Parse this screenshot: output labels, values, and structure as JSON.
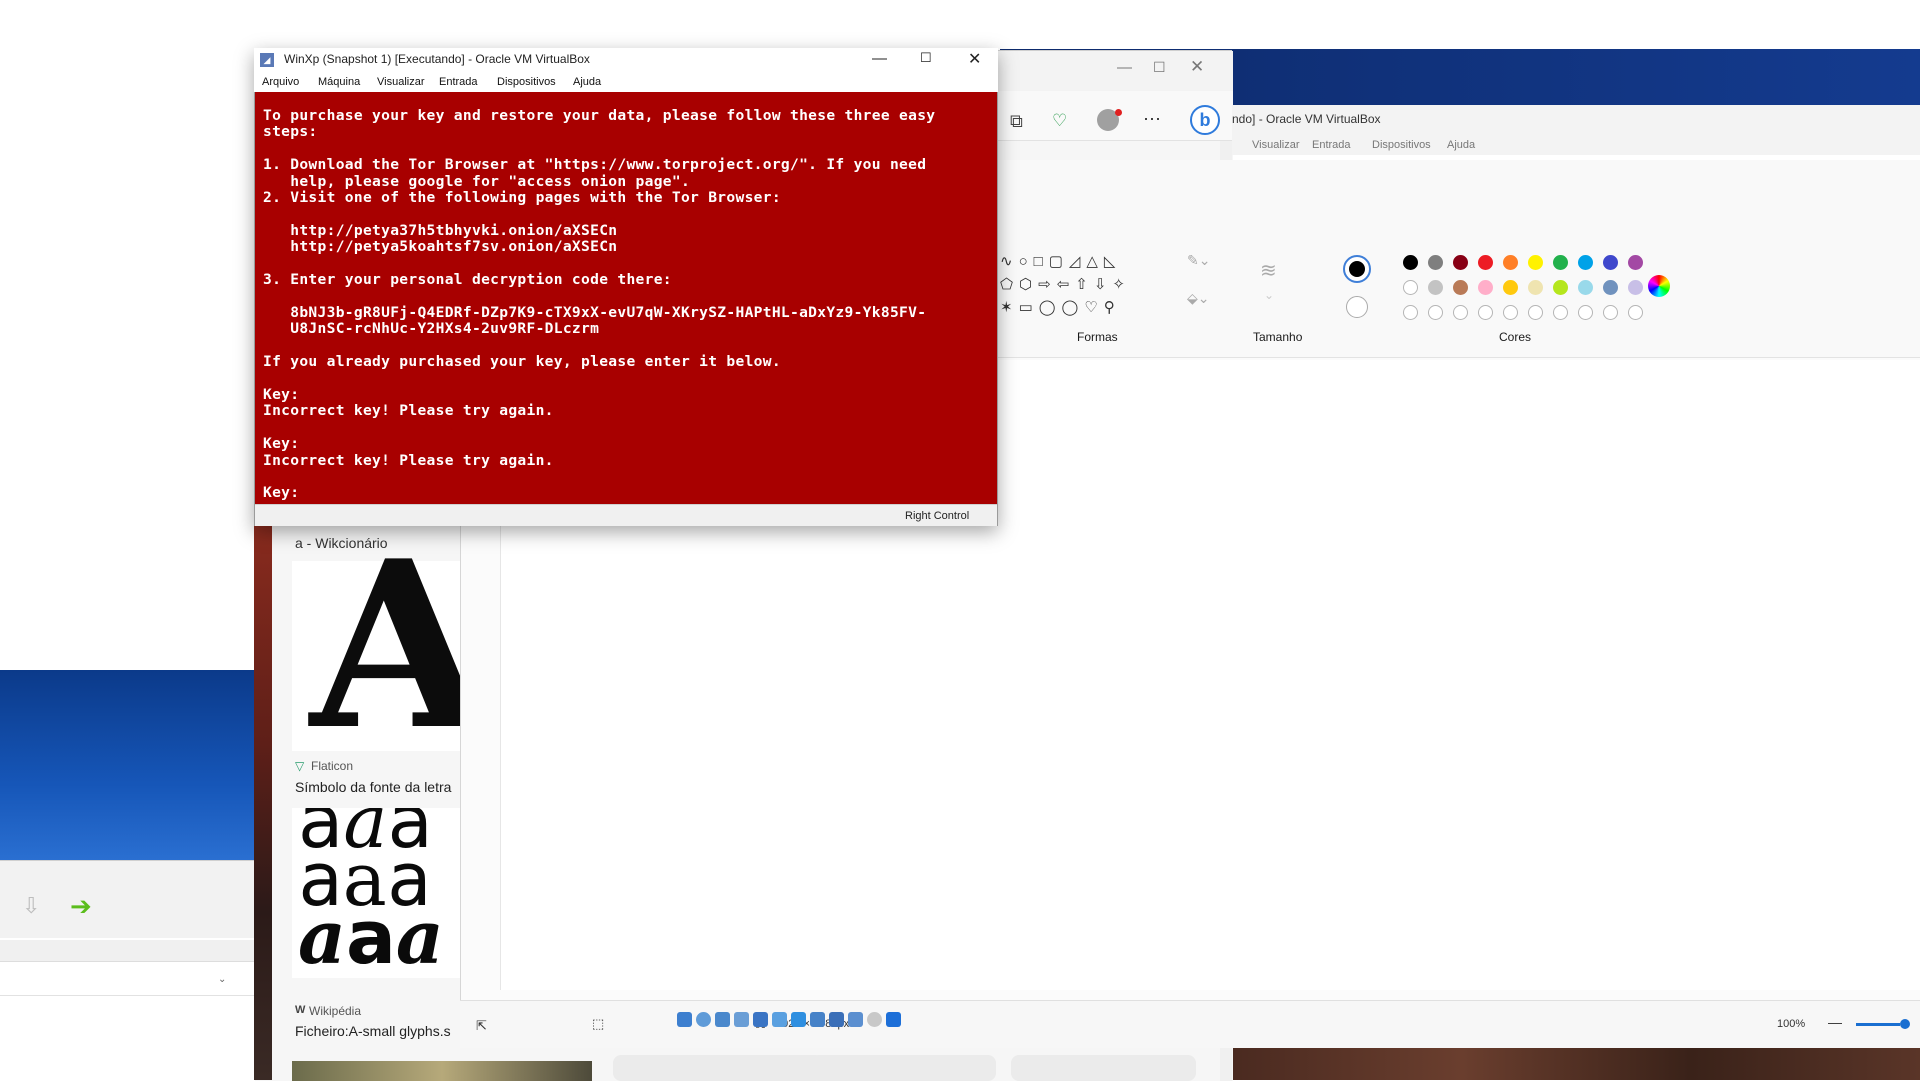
{
  "vm_window": {
    "title": "WinXp (Snapshot 1) [Executando] - Oracle VM VirtualBox",
    "menu": [
      "Arquivo",
      "Máquina",
      "Visualizar",
      "Entrada",
      "Dispositivos",
      "Ajuda"
    ],
    "status_host_key": "Right Control",
    "terminal_lines": [
      "To purchase your key and restore your data, please follow these three easy",
      "steps:",
      "",
      "1. Download the Tor Browser at \"https://www.torproject.org/\". If you need",
      "   help, please google for \"access onion page\".",
      "2. Visit one of the following pages with the Tor Browser:",
      "",
      "   http://petya37h5tbhyvki.onion/aXSECn",
      "   http://petya5koahtsf7sv.onion/aXSECn",
      "",
      "3. Enter your personal decryption code there:",
      "",
      "   8bNJ3b-gR8UFj-Q4EDRf-DZp7K9-cTX9xX-evU7qW-XKrySZ-HAPtHL-aDxYz9-Yk85FV-",
      "   U8JnSC-rcNhUc-Y2HXs4-2uv9RF-DLczrm",
      "",
      "If you already purchased your key, please enter it below.",
      "",
      "Key:",
      "Incorrect key! Please try again.",
      "",
      "Key:",
      "Incorrect key! Please try again.",
      "",
      "Key:"
    ]
  },
  "vbox2": {
    "title_fragment": "ndo] - Oracle VM VirtualBox",
    "menu": [
      "Visualizar",
      "Entrada",
      "Dispositivos",
      "Ajuda"
    ]
  },
  "browser": {
    "card1_caption": "a - Wikcionário",
    "card2_source": "Flaticon",
    "card2_caption": "Símbolo da fonte da letra",
    "card3_source": "Wikipédia",
    "card3_caption": "Ficheiro:A-small glyphs.s"
  },
  "paint": {
    "group_shapes": "Formas",
    "group_size": "Tamanho",
    "group_colors": "Cores",
    "canvas_size": "1920 × 1080px",
    "zoom": "100%",
    "palette_row1": [
      "#000000",
      "#7f7f7f",
      "#880015",
      "#ed1c24",
      "#ff7f27",
      "#fff200",
      "#22b14c",
      "#00a2e8",
      "#3f48cc",
      "#a349a4"
    ],
    "palette_row2": [
      "#ffffff",
      "#c3c3c3",
      "#b97a57",
      "#ffaec9",
      "#ffc90e",
      "#efe4b0",
      "#b5e61d",
      "#99d9ea",
      "#7092be",
      "#c8bfe7"
    ]
  }
}
